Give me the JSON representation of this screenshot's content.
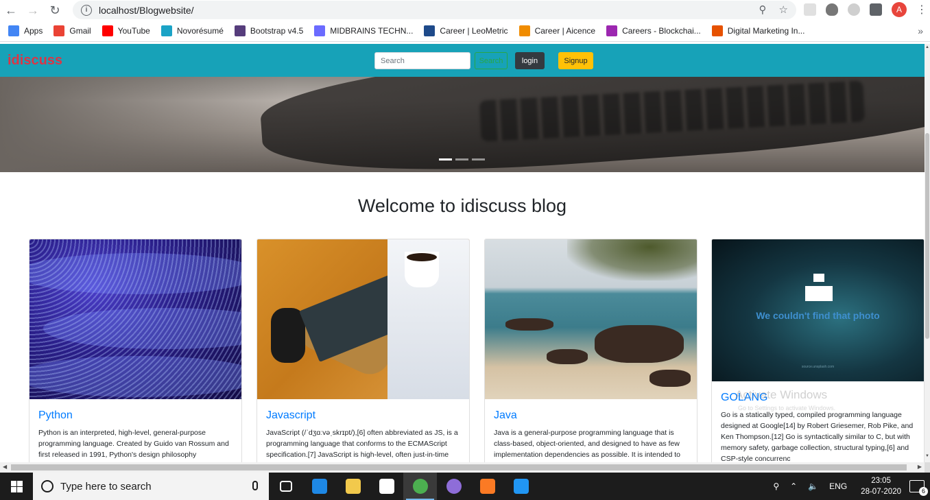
{
  "browser": {
    "url": "localhost/Blogwebsite/",
    "profile_initial": "A",
    "bookmarks": [
      {
        "label": "Apps",
        "icon": "apps-grid-icon",
        "color": "#4285f4"
      },
      {
        "label": "Gmail",
        "icon": "gmail-icon",
        "color": "#ea4335"
      },
      {
        "label": "YouTube",
        "icon": "youtube-icon",
        "color": "#ff0000"
      },
      {
        "label": "Novorésumé",
        "icon": "novoresume-icon",
        "color": "#1ba3c6"
      },
      {
        "label": "Bootstrap v4.5",
        "icon": "bootstrap-icon",
        "color": "#563d7c"
      },
      {
        "label": "MIDBRAINS TECHN...",
        "icon": "midbrains-icon",
        "color": "#6b6bff"
      },
      {
        "label": "Career | LeoMetric",
        "icon": "leometric-icon",
        "color": "#1e4a8a"
      },
      {
        "label": "Career | Aicence",
        "icon": "aicence-icon",
        "color": "#f08c00"
      },
      {
        "label": "Careers - Blockchai...",
        "icon": "blockchain-icon",
        "color": "#9c27b0"
      },
      {
        "label": "Digital Marketing In...",
        "icon": "digital-marketing-icon",
        "color": "#e65100"
      }
    ]
  },
  "site": {
    "brand": "idiscuss",
    "search_placeholder": "Search",
    "search_button": "Search",
    "login_button": "login",
    "signup_button": "Signup",
    "heading": "Welcome to idiscuss blog",
    "carousel_slides": 3,
    "carousel_active_index": 0,
    "colors": {
      "navbar": "#17a2b8",
      "brand": "#dc3545",
      "link": "#007bff",
      "signup": "#ffc107",
      "login": "#343a40"
    }
  },
  "cards": [
    {
      "title": "Python",
      "text": "Python is an interpreted, high-level, general-purpose programming language. Created by Guido van Rossum and first released in 1991, Python's design philosophy"
    },
    {
      "title": "Javascript",
      "text": "JavaScript (/ˈdʒɑːvəˌskrɪpt/),[6] often abbreviated as JS, is a programming language that conforms to the ECMAScript specification.[7] JavaScript is high-level, often just-in-time"
    },
    {
      "title": "Java",
      "text": "Java is a general-purpose programming language that is class-based, object-oriented, and designed to have as few implementation dependencies as possible. It is intended to"
    },
    {
      "title": "GOLANG",
      "text": "Go is a statically typed, compiled programming language designed at Google[14] by Robert Griesemer, Rob Pike, and Ken Thompson.[12] Go is syntactically similar to C, but with memory safety, garbage collection, structural typing,[6] and CSP-style concurrenc",
      "image_message": "We couldn't find that photo",
      "image_source": "source.unsplash.com"
    }
  ],
  "watermark": {
    "line1": "Activate Windows",
    "line2": "Go to Settings to activate Windows."
  },
  "taskbar": {
    "search_placeholder": "Type here to search",
    "language": "ENG",
    "time": "23:05",
    "date": "28-07-2020",
    "notification_count": "6",
    "apps": [
      {
        "name": "task-view",
        "color": "#ffffff"
      },
      {
        "name": "edge",
        "color": "#1e88e5"
      },
      {
        "name": "file-explorer",
        "color": "#f2c94c"
      },
      {
        "name": "store",
        "color": "#ffffff"
      },
      {
        "name": "chrome",
        "color": "#4caf50"
      },
      {
        "name": "github-desktop",
        "color": "#8e6dd8"
      },
      {
        "name": "xampp",
        "color": "#fb7a24"
      },
      {
        "name": "vscode",
        "color": "#2196f3"
      }
    ]
  }
}
